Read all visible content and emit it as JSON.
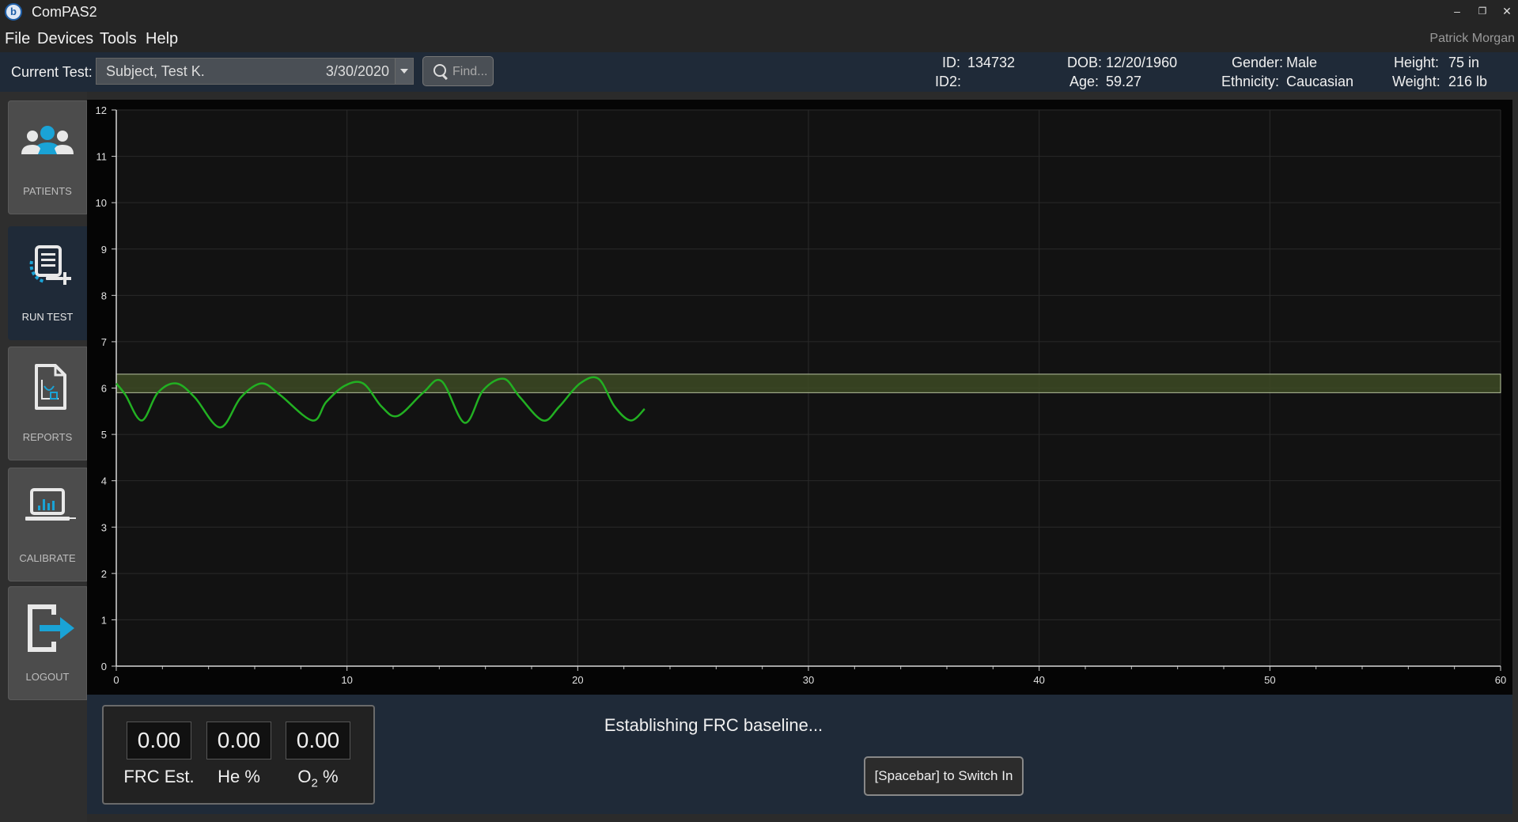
{
  "window": {
    "title": "ComPAS2",
    "minimize": "–",
    "restore": "❐",
    "close": "✕"
  },
  "menu": {
    "items": [
      "File",
      "Devices",
      "Tools",
      "Help"
    ],
    "user": "Patrick Morgan"
  },
  "header": {
    "current_test_label": "Current Test:",
    "test_name": "Subject, Test K.",
    "test_date": "3/30/2020",
    "find_placeholder": "Find...",
    "id_label": "ID:",
    "id_value": "134732",
    "id2_label": "ID2:",
    "id2_value": "",
    "dob_label": "DOB:",
    "dob_value": "12/20/1960",
    "age_label": "Age:",
    "age_value": "59.27",
    "gender_label": "Gender:",
    "gender_value": "Male",
    "ethnicity_label": "Ethnicity:",
    "ethnicity_value": "Caucasian",
    "height_label": "Height:",
    "height_value": "75 in",
    "weight_label": "Weight:",
    "weight_value": "216 lb"
  },
  "sidebar": {
    "items": [
      {
        "label": "PATIENTS",
        "icon": "patients-icon",
        "active": false
      },
      {
        "label": "RUN TEST",
        "icon": "run-test-icon",
        "active": true
      },
      {
        "label": "REPORTS",
        "icon": "reports-icon",
        "active": false
      },
      {
        "label": "CALIBRATE",
        "icon": "calibrate-icon",
        "active": false
      },
      {
        "label": "LOGOUT",
        "icon": "logout-icon",
        "active": false
      }
    ]
  },
  "colors": {
    "accent": "#1aa3d6",
    "trace": "#22b022",
    "band": "#3d4a24",
    "header_bg": "#1f2a38"
  },
  "chart_data": {
    "type": "line",
    "xlim": [
      0,
      60
    ],
    "ylim": [
      0,
      12
    ],
    "x_ticks": [
      0,
      10,
      20,
      30,
      40,
      50,
      60
    ],
    "y_ticks": [
      0,
      1,
      2,
      3,
      4,
      5,
      6,
      7,
      8,
      9,
      10,
      11,
      12
    ],
    "grid": true,
    "band": [
      5.9,
      6.3
    ],
    "series": [
      {
        "x": [
          0,
          0.4,
          1.1,
          1.8,
          2.6,
          3.4,
          4.5,
          5.4,
          6.3,
          7.1,
          8.5,
          9.1,
          9.9,
          10.7,
          11.5,
          12.2,
          13.3,
          14.1,
          15.1,
          15.9,
          16.8,
          17.5,
          18.5,
          19.2,
          20.1,
          20.9,
          21.6,
          22.3,
          22.9
        ],
        "y": [
          6.1,
          5.85,
          5.3,
          5.9,
          6.1,
          5.8,
          5.15,
          5.8,
          6.1,
          5.85,
          5.3,
          5.7,
          6.05,
          6.1,
          5.6,
          5.4,
          5.9,
          6.15,
          5.25,
          5.95,
          6.2,
          5.8,
          5.3,
          5.6,
          6.1,
          6.2,
          5.6,
          5.3,
          5.55
        ]
      }
    ]
  },
  "metrics": [
    {
      "value": "0.00",
      "label": "FRC Est."
    },
    {
      "value": "0.00",
      "label": "He %"
    },
    {
      "value": "0.00",
      "label_prefix": "O",
      "label_sub": "2",
      "label_suffix": " %"
    }
  ],
  "status": {
    "message": "Establishing FRC baseline...",
    "switch_button": "[Spacebar] to Switch In"
  }
}
